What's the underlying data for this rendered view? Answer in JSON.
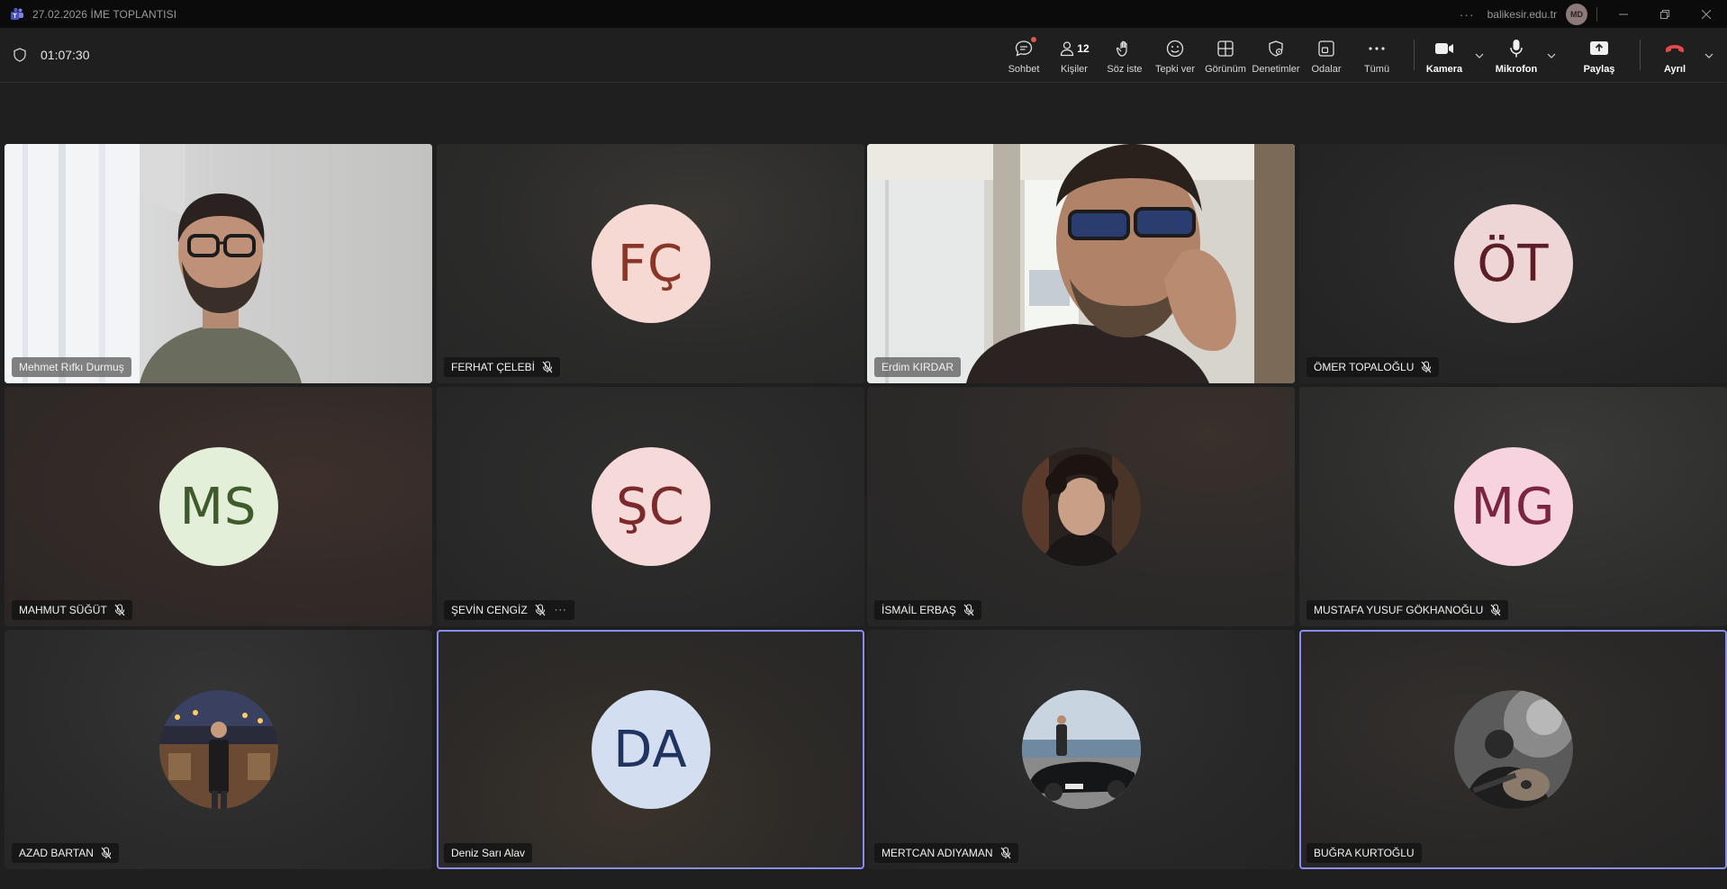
{
  "window": {
    "title": "27.02.2026 İME TOPLANTISI",
    "org": "balikesir.edu.tr",
    "user_initials": "MD",
    "more_label": "···"
  },
  "meeting": {
    "timer": "01:07:30"
  },
  "toolbar": {
    "chat": "Sohbet",
    "people": "Kişiler",
    "people_count": "12",
    "raise_hand": "Söz iste",
    "react": "Tepki ver",
    "view": "Görünüm",
    "controls": "Denetimler",
    "rooms": "Odalar",
    "more": "Tümü",
    "camera": "Kamera",
    "mic": "Mikrofon",
    "share": "Paylaş",
    "leave": "Ayrıl"
  },
  "participants": [
    {
      "name": "Mehmet Rıfkı Durmuş",
      "type": "video",
      "muted": false
    },
    {
      "name": "FERHAT ÇELEBİ",
      "type": "initials",
      "initials": "FÇ",
      "bg": "#f6d9d3",
      "fg": "#8a3525",
      "muted": true
    },
    {
      "name": "Erdim KIRDAR",
      "type": "video",
      "muted": false
    },
    {
      "name": "ÖMER TOPALOĞLU",
      "type": "initials",
      "initials": "ÖT",
      "bg": "#eed6d6",
      "fg": "#5a1e24",
      "muted": true
    },
    {
      "name": "MAHMUT SÜĞÜT",
      "type": "initials",
      "initials": "MS",
      "bg": "#e3efd9",
      "fg": "#3f5b2c",
      "muted": true
    },
    {
      "name": "ŞEVİN CENGİZ",
      "type": "initials",
      "initials": "ŞC",
      "bg": "#f6d9d9",
      "fg": "#7a2a2a",
      "muted": true,
      "more": "···"
    },
    {
      "name": "İSMAİL ERBAŞ",
      "type": "photo",
      "muted": true
    },
    {
      "name": "MUSTAFA YUSUF GÖKHANOĞLU",
      "type": "initials",
      "initials": "MG",
      "bg": "#f6d3de",
      "fg": "#7a2442",
      "muted": true
    },
    {
      "name": "AZAD BARTAN",
      "type": "photo",
      "muted": true
    },
    {
      "name": "Deniz Sarı Alav",
      "type": "initials",
      "initials": "DA",
      "bg": "#d3def0",
      "fg": "#1f3461",
      "muted": false,
      "active": true
    },
    {
      "name": "MERTCAN ADIYAMAN",
      "type": "photo",
      "muted": true
    },
    {
      "name": "BUĞRA KURTOĞLU",
      "type": "photo",
      "muted": false,
      "active": true
    }
  ]
}
